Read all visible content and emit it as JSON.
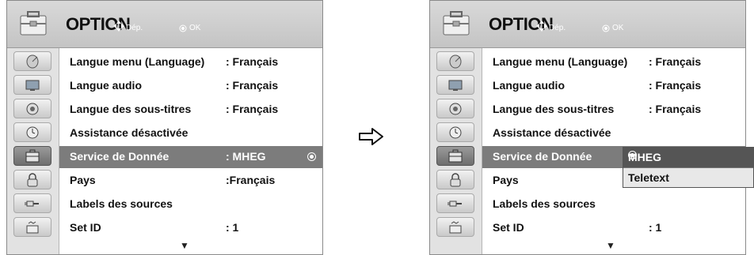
{
  "colors": {
    "selected_row": "#7c7c7c",
    "header": "#c8c8c8",
    "sidebar": "#e2e2e2",
    "popup_selected": "#555555"
  },
  "left_panel": {
    "title": "OPTION",
    "hint_move": "Dép.",
    "hint_ok": "OK",
    "sidebar_icons": [
      "satellite-dish-icon",
      "tv-picture-icon",
      "speaker-icon",
      "clock-icon",
      "toolbox-option-icon",
      "lock-icon",
      "input-plug-icon",
      "usb-media-icon"
    ],
    "rows": [
      {
        "label": "Langue menu (Language)",
        "value": ": Français"
      },
      {
        "label": "Langue audio",
        "value": ": Français"
      },
      {
        "label": "Langue des sous-titres",
        "value": ": Français"
      },
      {
        "label": "Assistance désactivée",
        "value": ""
      },
      {
        "label": "Service de Donnée",
        "value": ": MHEG"
      },
      {
        "label": "Pays",
        "value": ":Français"
      },
      {
        "label": "Labels des sources",
        "value": ""
      },
      {
        "label": "Set ID",
        "value": ": 1"
      }
    ],
    "more_indicator": "▼"
  },
  "transition_arrow": "right-arrow-icon",
  "right_panel": {
    "title": "OPTION",
    "hint_move": "Dép.",
    "hint_ok": "OK",
    "rows": [
      {
        "label": "Langue menu (Language)",
        "value": ": Français"
      },
      {
        "label": "Langue audio",
        "value": ": Français"
      },
      {
        "label": "Langue des sous-titres",
        "value": ": Français"
      },
      {
        "label": "Assistance désactivée",
        "value": ""
      },
      {
        "label": "Service de Donnée",
        "value": ""
      },
      {
        "label": "Pays",
        "value": ""
      },
      {
        "label": "Labels des sources",
        "value": ""
      },
      {
        "label": "Set ID",
        "value": ": 1"
      }
    ],
    "more_indicator": "▼",
    "popup": {
      "options": [
        "MHEG",
        "Teletext"
      ],
      "selected": "MHEG"
    }
  }
}
